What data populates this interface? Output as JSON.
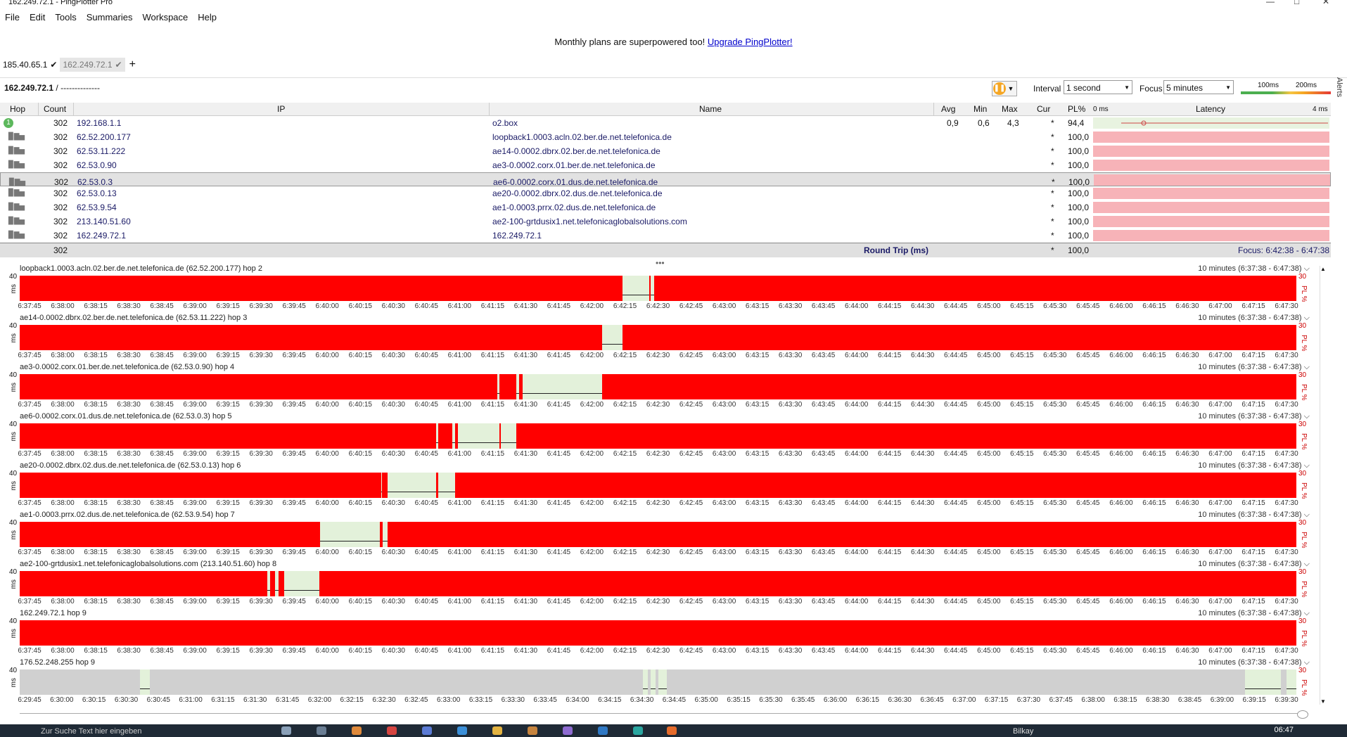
{
  "window": {
    "title": "162.249.72.1 - PingPlotter Pro",
    "min_icon": "minimize-icon",
    "max_icon": "maximize-icon",
    "close_icon": "close-icon"
  },
  "menu": [
    "File",
    "Edit",
    "Tools",
    "Summaries",
    "Workspace",
    "Help"
  ],
  "promo": {
    "text": "Monthly plans are superpowered too! ",
    "link": "Upgrade PingPlotter!"
  },
  "tabs": [
    {
      "label": "185.40.65.1",
      "icon": "check-icon"
    },
    {
      "label": "162.249.72.1",
      "icon": "check-icon",
      "active": true
    }
  ],
  "toolbar": {
    "target": "162.249.72.1",
    "target_suffix": " / --------------",
    "interval_label": "Interval",
    "interval_value": "1 second",
    "focus_label": "Focus",
    "focus_value": "5 minutes",
    "scale_100": "100ms",
    "scale_200": "200ms",
    "alerts": "Alerts"
  },
  "columns": {
    "hop": "Hop",
    "count": "Count",
    "ip": "IP",
    "name": "Name",
    "avg": "Avg",
    "min": "Min",
    "max": "Max",
    "cur": "Cur",
    "pl": "PL%",
    "lat_start": "0 ms",
    "latency": "Latency",
    "lat_end": "4 ms"
  },
  "hops": [
    {
      "hop": "1",
      "count": "302",
      "ip": "192.168.1.1",
      "name": "o2.box",
      "avg": "0,9",
      "min": "0,6",
      "max": "4,3",
      "cur": "*",
      "pl": "94,4"
    },
    {
      "hop": "2",
      "count": "302",
      "ip": "62.52.200.177",
      "name": "loopback1.0003.acln.02.ber.de.net.telefonica.de",
      "avg": "",
      "min": "",
      "max": "",
      "cur": "*",
      "pl": "100,0"
    },
    {
      "hop": "3",
      "count": "302",
      "ip": "62.53.11.222",
      "name": "ae14-0.0002.dbrx.02.ber.de.net.telefonica.de",
      "avg": "",
      "min": "",
      "max": "",
      "cur": "*",
      "pl": "100,0"
    },
    {
      "hop": "4",
      "count": "302",
      "ip": "62.53.0.90",
      "name": "ae3-0.0002.corx.01.ber.de.net.telefonica.de",
      "avg": "",
      "min": "",
      "max": "",
      "cur": "*",
      "pl": "100,0"
    },
    {
      "hop": "5",
      "count": "302",
      "ip": "62.53.0.3",
      "name": "ae6-0.0002.corx.01.dus.de.net.telefonica.de",
      "avg": "",
      "min": "",
      "max": "",
      "cur": "*",
      "pl": "100,0"
    },
    {
      "hop": "6",
      "count": "302",
      "ip": "62.53.0.13",
      "name": "ae20-0.0002.dbrx.02.dus.de.net.telefonica.de",
      "avg": "",
      "min": "",
      "max": "",
      "cur": "*",
      "pl": "100,0"
    },
    {
      "hop": "7",
      "count": "302",
      "ip": "62.53.9.54",
      "name": "ae1-0.0003.prrx.02.dus.de.net.telefonica.de",
      "avg": "",
      "min": "",
      "max": "",
      "cur": "*",
      "pl": "100,0"
    },
    {
      "hop": "8",
      "count": "302",
      "ip": "213.140.51.60",
      "name": "ae2-100-grtdusix1.net.telefonicaglobalsolutions.com",
      "avg": "",
      "min": "",
      "max": "",
      "cur": "*",
      "pl": "100,0"
    },
    {
      "hop": "9",
      "count": "302",
      "ip": "162.249.72.1",
      "name": "162.249.72.1",
      "avg": "",
      "min": "",
      "max": "",
      "cur": "*",
      "pl": "100,0"
    }
  ],
  "summary": {
    "count": "302",
    "label": "Round Trip (ms)",
    "cur": "*",
    "pl": "100,0",
    "focus": "Focus: 6:42:38 - 6:47:38"
  },
  "graphs": [
    {
      "title": "loopback1.0003.acln.02.ber.de.net.telefonica.de (62.52.200.177) hop 2",
      "range": "10 minutes (6:37:38 - 6:47:38)",
      "y": "40",
      "yu": "ms",
      "pl": "30",
      "plu": "PL %",
      "bg": "red",
      "ok": [
        [
          0.472,
          0.493
        ],
        [
          0.494,
          0.497
        ]
      ],
      "axis": "main"
    },
    {
      "title": "ae14-0.0002.dbrx.02.ber.de.net.telefonica.de (62.53.11.222) hop 3",
      "range": "10 minutes (6:37:38 - 6:47:38)",
      "y": "40",
      "yu": "ms",
      "pl": "30",
      "plu": "PL %",
      "bg": "red",
      "ok": [
        [
          0.456,
          0.472
        ]
      ],
      "axis": "main"
    },
    {
      "title": "ae3-0.0002.corx.01.ber.de.net.telefonica.de (62.53.0.90) hop 4",
      "range": "10 minutes (6:37:38 - 6:47:38)",
      "y": "40",
      "yu": "ms",
      "pl": "30",
      "plu": "PL %",
      "bg": "red",
      "ok": [
        [
          0.374,
          0.376
        ],
        [
          0.389,
          0.391
        ],
        [
          0.394,
          0.456
        ]
      ],
      "axis": "main"
    },
    {
      "title": "ae6-0.0002.corx.01.dus.de.net.telefonica.de (62.53.0.3) hop 5",
      "range": "10 minutes (6:37:38 - 6:47:38)",
      "y": "40",
      "yu": "ms",
      "pl": "30",
      "plu": "PL %",
      "bg": "red",
      "ok": [
        [
          0.326,
          0.328
        ],
        [
          0.339,
          0.341
        ],
        [
          0.343,
          0.376
        ],
        [
          0.377,
          0.389
        ]
      ],
      "axis": "main"
    },
    {
      "title": "ae20-0.0002.dbrx.02.dus.de.net.telefonica.de (62.53.0.13) hop 6",
      "range": "10 minutes (6:37:38 - 6:47:38)",
      "y": "40",
      "yu": "ms",
      "pl": "30",
      "plu": "PL %",
      "bg": "red",
      "ok": [
        [
          0.283,
          0.284
        ],
        [
          0.288,
          0.326
        ],
        [
          0.328,
          0.341
        ]
      ],
      "axis": "main"
    },
    {
      "title": "ae1-0.0003.prrx.02.dus.de.net.telefonica.de (62.53.9.54) hop 7",
      "range": "10 minutes (6:37:38 - 6:47:38)",
      "y": "40",
      "yu": "ms",
      "pl": "30",
      "plu": "PL %",
      "bg": "red",
      "ok": [
        [
          0.235,
          0.282
        ],
        [
          0.284,
          0.288
        ]
      ],
      "axis": "main"
    },
    {
      "title": "ae2-100-grtdusix1.net.telefonicaglobalsolutions.com (213.140.51.60) hop 8",
      "range": "10 minutes (6:37:38 - 6:47:38)",
      "y": "40",
      "yu": "ms",
      "pl": "30",
      "plu": "PL %",
      "bg": "red",
      "ok": [
        [
          0.194,
          0.196
        ],
        [
          0.2,
          0.203
        ],
        [
          0.207,
          0.235
        ]
      ],
      "axis": "main"
    },
    {
      "title": "162.249.72.1 hop 9",
      "range": "10 minutes (6:37:38 - 6:47:38)",
      "y": "40",
      "yu": "ms",
      "pl": "30",
      "plu": "PL %",
      "bg": "red",
      "ok": [],
      "axis": "main"
    },
    {
      "title": "176.52.248.255 hop 9",
      "range": "10 minutes (6:37:38 - 6:47:38)",
      "y": "40",
      "yu": "ms",
      "pl": "30",
      "plu": "PL %",
      "bg": "grey",
      "ok": [
        [
          0.094,
          0.102
        ],
        [
          0.488,
          0.492
        ],
        [
          0.494,
          0.498
        ],
        [
          0.5,
          0.507
        ],
        [
          0.96,
          0.988
        ],
        [
          0.992,
          1.0
        ]
      ],
      "axis": "alt"
    }
  ],
  "axis_main": [
    "6:37:45",
    "6:38:00",
    "6:38:15",
    "6:38:30",
    "6:38:45",
    "6:39:00",
    "6:39:15",
    "6:39:30",
    "6:39:45",
    "6:40:00",
    "6:40:15",
    "6:40:30",
    "6:40:45",
    "6:41:00",
    "6:41:15",
    "6:41:30",
    "6:41:45",
    "6:42:00",
    "6:42:15",
    "6:42:30",
    "6:42:45",
    "6:43:00",
    "6:43:15",
    "6:43:30",
    "6:43:45",
    "6:44:00",
    "6:44:15",
    "6:44:30",
    "6:44:45",
    "6:45:00",
    "6:45:15",
    "6:45:30",
    "6:45:45",
    "6:46:00",
    "6:46:15",
    "6:46:30",
    "6:47:00",
    "6:47:15",
    "6:47:30"
  ],
  "axis_alt": [
    "6:29:45",
    "6:30:00",
    "6:30:15",
    "6:30:30",
    "6:30:45",
    "6:31:00",
    "6:31:15",
    "6:31:30",
    "6:31:45",
    "6:32:00",
    "6:32:15",
    "6:32:30",
    "6:32:45",
    "6:33:00",
    "6:33:15",
    "6:33:30",
    "6:33:45",
    "6:34:00",
    "6:34:15",
    "6:34:30",
    "6:34:45",
    "6:35:00",
    "6:35:15",
    "6:35:30",
    "6:35:45",
    "6:36:00",
    "6:36:15",
    "6:36:30",
    "6:36:45",
    "6:37:00",
    "6:37:15",
    "6:37:30",
    "6:37:45",
    "6:38:00",
    "6:38:15",
    "6:38:30",
    "6:38:45",
    "6:39:00",
    "6:39:15",
    "6:39:30"
  ],
  "taskbar": {
    "search": "Zur Suche Text hier eingeben",
    "user": "Bilkay",
    "clock": "06:47"
  }
}
